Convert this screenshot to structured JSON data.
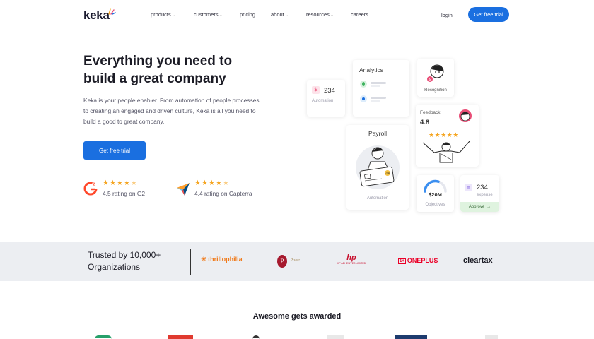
{
  "header": {
    "logo": "keka",
    "nav": [
      {
        "label": "products",
        "has_caret": true
      },
      {
        "label": "customers",
        "has_caret": true
      },
      {
        "label": "pricing",
        "has_caret": false
      },
      {
        "label": "about",
        "has_caret": true
      },
      {
        "label": "resources",
        "has_caret": true
      },
      {
        "label": "careers",
        "has_caret": false
      }
    ],
    "login": "login",
    "cta": "Get free trial"
  },
  "hero": {
    "title_line1": "Everything you need to",
    "title_line2": "build a great company",
    "description": "Keka is your people enabler. From automation of people processes to creating an engaged and driven culture, Keka is all you need to build a good to great company.",
    "cta": "Get free trial",
    "ratings": [
      {
        "source": "G2",
        "stars": 4.5,
        "text": "4.5 rating on G2"
      },
      {
        "source": "Capterra",
        "stars": 4.5,
        "text": "4.4 rating on Capterra"
      }
    ]
  },
  "illustration": {
    "automation_small": {
      "value": "234",
      "label": "Automation"
    },
    "analytics": {
      "title": "Analytics"
    },
    "recognition": {
      "label": "Recognition"
    },
    "feedback": {
      "title": "Feedback",
      "value": "4.8"
    },
    "payroll": {
      "title": "Payroll",
      "label": "Automation",
      "card_tag": "GP"
    },
    "objectives": {
      "value": "$20M",
      "label": "Objectives",
      "progress": 0.6
    },
    "expense": {
      "value": "234",
      "label": "expense",
      "action": "Approve"
    }
  },
  "trusted": {
    "line1": "Trusted by 10,000+",
    "line2": "Organizations",
    "brands": [
      "thrillophilia",
      "Pulse",
      "HP ADHESIVES LIMITED",
      "ONEPLUS",
      "cleartax"
    ]
  },
  "awards": {
    "title": "Awesome gets awarded"
  },
  "colors": {
    "primary": "#1a6fe0",
    "star": "#f5a623",
    "band": "#eceef2",
    "approve": "#dff3df"
  }
}
